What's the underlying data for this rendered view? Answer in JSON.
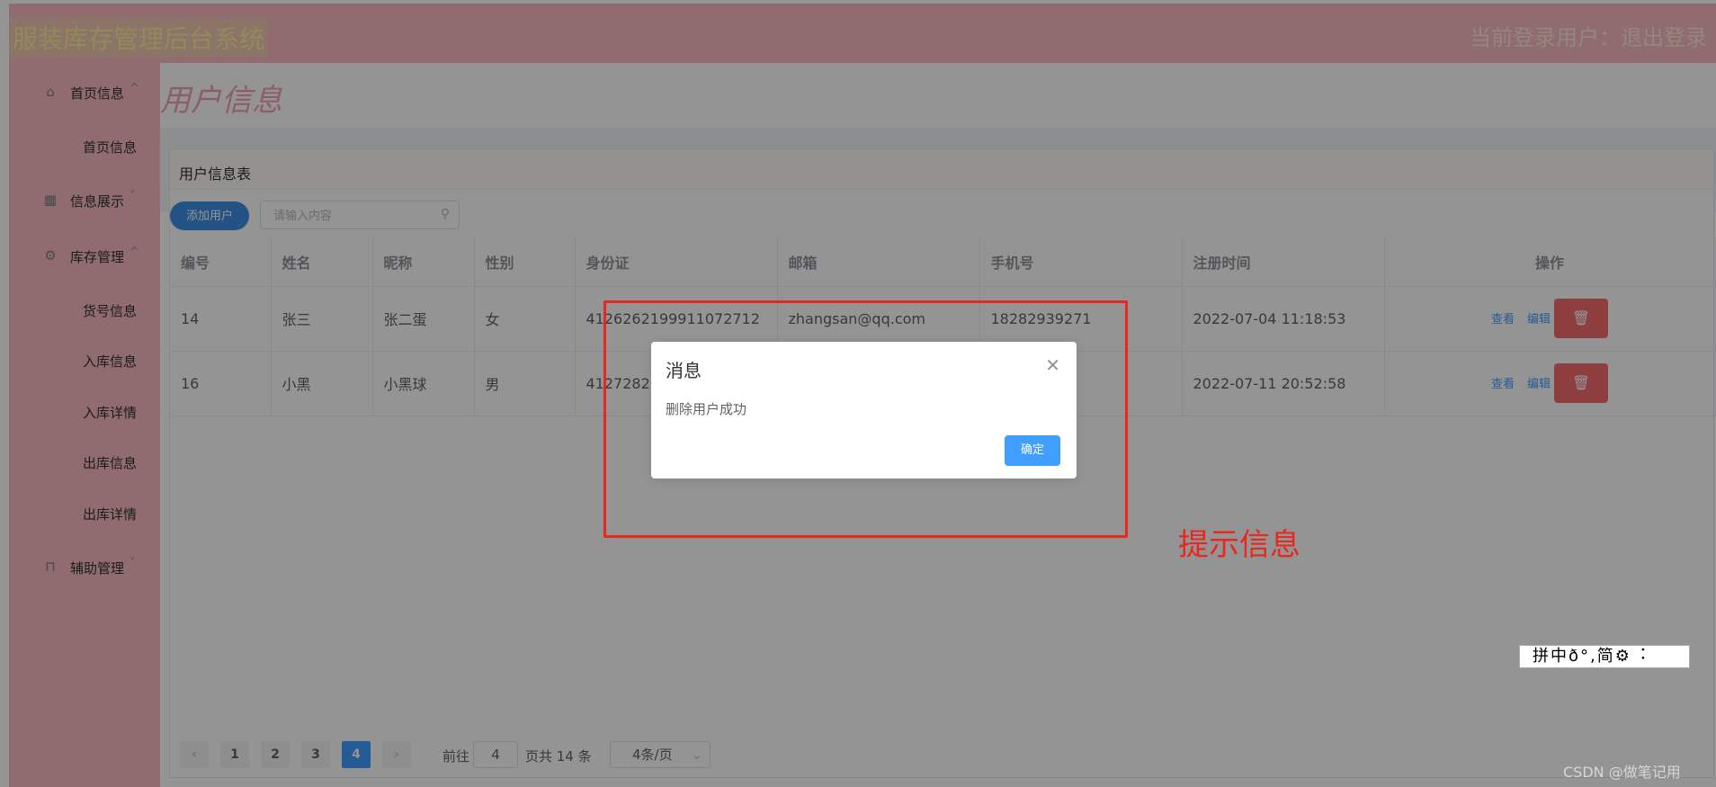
{
  "header": {
    "title": "服装库存管理后台系统",
    "user_text": "当前登录用户：退出登录"
  },
  "sidebar": {
    "groups": [
      {
        "label": "首页信息",
        "icon": "home-icon",
        "chevron": "^"
      },
      {
        "label": "信息展示",
        "icon": "grid-icon",
        "chevron": "v"
      },
      {
        "label": "库存管理",
        "icon": "gear-icon",
        "chevron": "^"
      },
      {
        "label": "辅助管理",
        "icon": "lock-icon",
        "chevron": "v"
      }
    ],
    "subitems": [
      "首页信息",
      "货号信息",
      "入库信息",
      "入库详情",
      "出库信息",
      "出库详情"
    ]
  },
  "main": {
    "page_title": "用户信息",
    "card_title": "用户信息表",
    "add_button": "添加用户",
    "search_placeholder": "请输入内容",
    "table": {
      "columns": [
        "编号",
        "姓名",
        "昵称",
        "性别",
        "身份证",
        "邮箱",
        "手机号",
        "注册时间",
        "操作"
      ],
      "rows": [
        {
          "id": "14",
          "name": "张三",
          "nick": "张二蛋",
          "gender": "女",
          "idcard": "4126262199911072712",
          "email": "zhangsan@qq.com",
          "phone": "18282939271",
          "reg": "2022-07-04 11:18:53"
        },
        {
          "id": "16",
          "name": "小黑",
          "nick": "小黑球",
          "gender": "男",
          "idcard": "412728200",
          "email": "",
          "phone": "",
          "reg": "2022-07-11 20:52:58"
        }
      ],
      "view_label": "查看",
      "edit_label": "编辑"
    },
    "pagination": {
      "pages": [
        "1",
        "2",
        "3",
        "4"
      ],
      "current": "4",
      "goto_label": "前往",
      "goto_value": "4",
      "total_text": "页共 14 条",
      "page_size": "4条/页"
    }
  },
  "dialog": {
    "title": "消息",
    "message": "删除用户成功",
    "confirm": "确定"
  },
  "annotation": {
    "label": "提示信息"
  },
  "ime_bar": {
    "text": "拼中ð°,简⚙︓"
  },
  "watermark": "CSDN @做笔记用",
  "colors": {
    "header_bg": "#f8b9c0",
    "primary": "#409eff",
    "danger": "#f56c6c",
    "annotation": "#e8281e"
  }
}
